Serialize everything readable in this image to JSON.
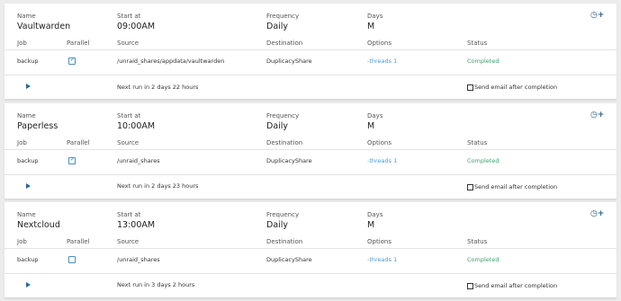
{
  "labels": {
    "name": "Name",
    "start_at": "Start at",
    "frequency": "Frequency",
    "days": "Days",
    "job": "Job",
    "parallel": "Parallel",
    "source": "Source",
    "destination": "Destination",
    "options": "Options",
    "status": "Status",
    "send_email": "Send email after completion"
  },
  "icons": {
    "clock": "clock-icon",
    "add": "plus-icon",
    "play": "play-icon",
    "checkbox": "checkbox-icon"
  },
  "colors": {
    "link": "#4a9ad6",
    "completed": "#3aa36b",
    "icon": "#2a5f86"
  },
  "schedules": [
    {
      "name": "Vaultwarden",
      "start_at": "09:00AM",
      "frequency": "Daily",
      "days": "M",
      "job": "backup",
      "parallel": true,
      "source": "/unraid_shares/appdata/vaultwarden",
      "destination": "DuplicacyShare",
      "options": "-threads 1",
      "status": "Completed",
      "next_run": "Next run in 2 days 22 hours",
      "send_email": false
    },
    {
      "name": "Paperless",
      "start_at": "10:00AM",
      "frequency": "Daily",
      "days": "M",
      "job": "backup",
      "parallel": true,
      "source": "/unraid_shares",
      "destination": "DuplicacyShare",
      "options": "-threads 1",
      "status": "Completed",
      "next_run": "Next run in 2 days 23 hours",
      "send_email": false
    },
    {
      "name": "Nextcloud",
      "start_at": "13:00AM",
      "frequency": "Daily",
      "days": "M",
      "job": "backup",
      "parallel": false,
      "source": "/unraid_shares",
      "destination": "DuplicacyShare",
      "options": "-threads 1",
      "status": "Completed",
      "next_run": "Next run in 3 days 2 hours",
      "send_email": false
    }
  ]
}
